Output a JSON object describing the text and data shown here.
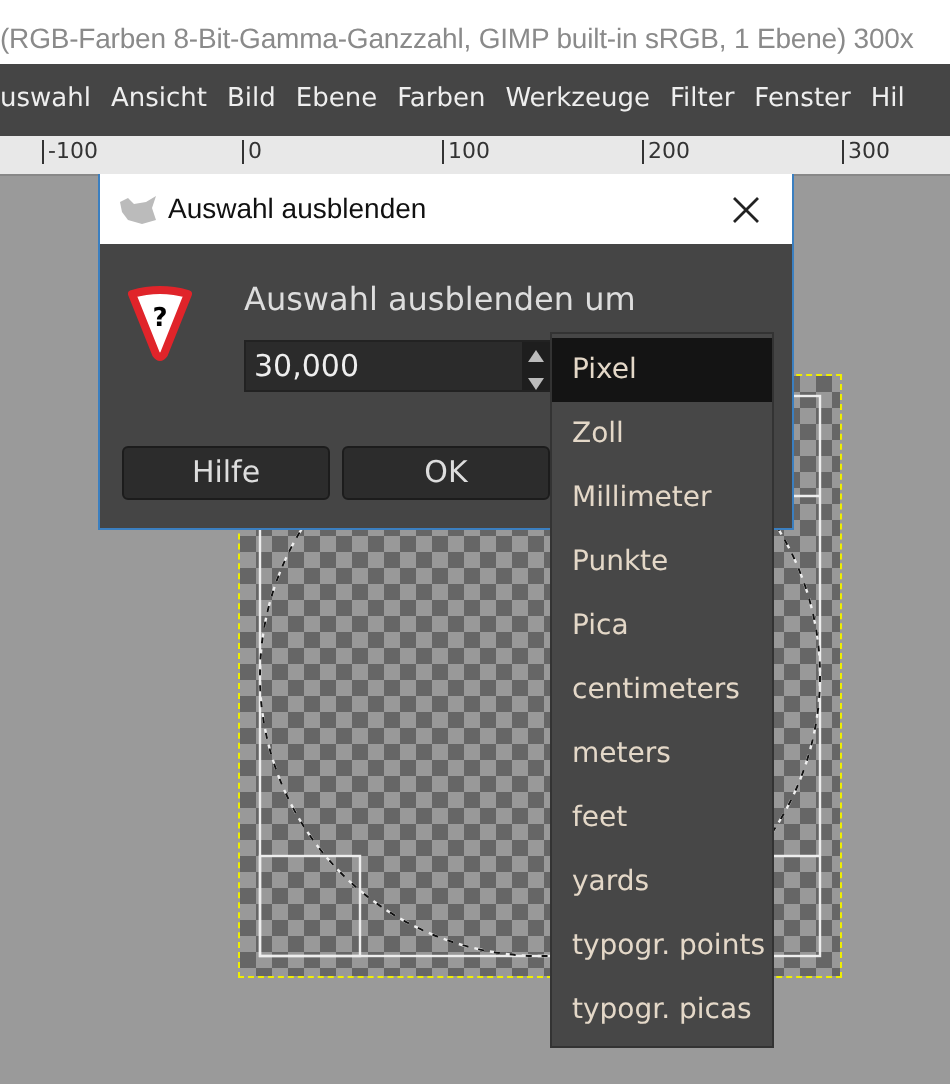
{
  "window": {
    "title": "(RGB-Farben 8-Bit-Gamma-Ganzzahl, GIMP built-in sRGB, 1 Ebene) 300x"
  },
  "menubar": [
    "uswahl",
    "Ansicht",
    "Bild",
    "Ebene",
    "Farben",
    "Werkzeuge",
    "Filter",
    "Fenster",
    "Hil"
  ],
  "ruler": [
    "-100",
    "0",
    "100",
    "200",
    "300"
  ],
  "dialog": {
    "title": "Auswahl ausblenden",
    "icon_glyph": "?",
    "label": "Auswahl ausblenden um",
    "value": "30,000",
    "buttons": [
      "Hilfe",
      "OK"
    ]
  },
  "unit_menu": [
    {
      "label": "Pixel",
      "selected": true
    },
    {
      "label": "Zoll",
      "selected": false
    },
    {
      "label": "Millimeter",
      "selected": false
    },
    {
      "label": "Punkte",
      "selected": false
    },
    {
      "label": "Pica",
      "selected": false
    },
    {
      "label": "centimeters",
      "selected": false
    },
    {
      "label": "meters",
      "selected": false
    },
    {
      "label": "feet",
      "selected": false
    },
    {
      "label": "yards",
      "selected": false
    },
    {
      "label": "typogr. points",
      "selected": false
    },
    {
      "label": "typogr. picas",
      "selected": false
    }
  ]
}
